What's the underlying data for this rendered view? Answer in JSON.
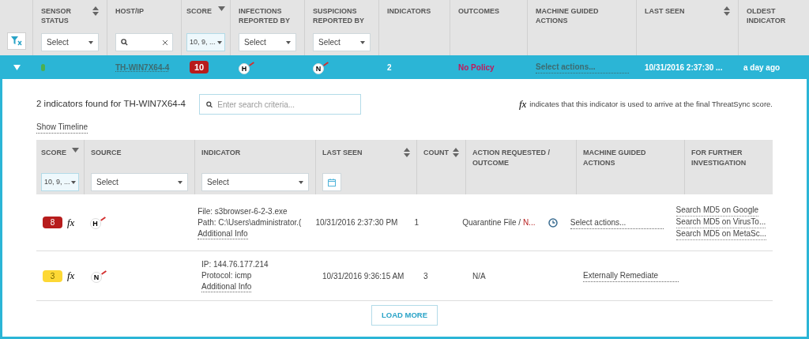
{
  "header": {
    "columns": [
      {
        "label": "SENSOR STATUS",
        "sortable": true,
        "sorted": false,
        "filter": {
          "kind": "select",
          "value": "Select"
        }
      },
      {
        "label": "HOST/IP",
        "sortable": false,
        "sorted": false,
        "filter": {
          "kind": "search"
        }
      },
      {
        "label": "SCORE",
        "sortable": true,
        "sorted": true,
        "filter": {
          "kind": "multi",
          "value": "10, 9, ..."
        }
      },
      {
        "label": "INFECTIONS REPORTED BY",
        "sortable": false,
        "sorted": false,
        "filter": {
          "kind": "select",
          "value": "Select"
        }
      },
      {
        "label": "SUSPICIONS REPORTED BY",
        "sortable": false,
        "sorted": false,
        "filter": {
          "kind": "select",
          "value": "Select"
        }
      },
      {
        "label": "INDICATORS",
        "sortable": false,
        "sorted": false
      },
      {
        "label": "OUTCOMES",
        "sortable": false,
        "sorted": false
      },
      {
        "label": "MACHINE GUIDED ACTIONS",
        "sortable": false,
        "sorted": false
      },
      {
        "label": "LAST SEEN",
        "sortable": true,
        "sorted": false
      },
      {
        "label": "OLDEST INDICATOR",
        "sortable": false,
        "sorted": false
      }
    ]
  },
  "host_row": {
    "expanded": true,
    "status": {
      "color": "#4caf50"
    },
    "host": "TH-WIN7X64-4",
    "score": {
      "text": "10",
      "color": "#b71c1c"
    },
    "infections_source": "H",
    "suspicions_source": "N",
    "indicators": "2",
    "outcome": "No Policy",
    "action": "Select actions...",
    "last_seen": "10/31/2016 2:37:30 ...",
    "oldest": "a day ago"
  },
  "details": {
    "title": "2 indicators found for TH-WIN7X64-4",
    "search": {
      "placeholder": "Enter search criteria..."
    },
    "fx_symbol": "fx",
    "fx_note": "indicates that this indicator is used to arrive at the final ThreatSync score.",
    "timeline_link": "Show Timeline",
    "columns": [
      {
        "label": "SCORE",
        "sortable": true,
        "sorted": true,
        "filter": {
          "kind": "multi",
          "value": "10, 9, ..."
        }
      },
      {
        "label": "SOURCE",
        "sortable": false,
        "sorted": false,
        "filter": {
          "kind": "select",
          "value": "Select"
        }
      },
      {
        "label": "INDICATOR",
        "sortable": false,
        "sorted": false,
        "filter": {
          "kind": "select",
          "value": "Select"
        }
      },
      {
        "label": "LAST SEEN",
        "sortable": true,
        "sorted": false,
        "filter": {
          "kind": "date"
        }
      },
      {
        "label": "COUNT",
        "sortable": true,
        "sorted": false
      },
      {
        "label": "ACTION REQUESTED / OUTCOME",
        "sortable": false,
        "sorted": false
      },
      {
        "label": "MACHINE GUIDED ACTIONS",
        "sortable": false,
        "sorted": false
      },
      {
        "label": "FOR FURTHER INVESTIGATION",
        "sortable": false,
        "sorted": false
      }
    ],
    "rows": [
      {
        "score": "8",
        "color": "#b71c1c",
        "fx": "fx",
        "source": "H",
        "indicator": [
          "File: s3browser-6-2-3.exe",
          "Path: C:\\Users\\administrator.("
        ],
        "info_link": "Additional Info",
        "last_seen": "10/31/2016 2:37:30 PM",
        "count": "1",
        "action": "Quarantine File / ",
        "outcome": "N...",
        "history": true,
        "guided_action": "Select actions...",
        "links": [
          "Search MD5 on Google",
          "Search MD5 on VirusTo...",
          "Search MD5 on MetaSc..."
        ]
      },
      {
        "score": "3",
        "color": "#fdd835",
        "fx": "fx",
        "source": "N",
        "indicator": [
          "IP: 144.76.177.214",
          "Protocol: icmp"
        ],
        "info_link": "Additional Info",
        "last_seen": "10/31/2016 9:36:15 AM",
        "count": "3",
        "action": "N/A",
        "history": false,
        "guided_action": "Externally Remediate",
        "links": []
      }
    ],
    "load_more": "LOAD MORE"
  }
}
